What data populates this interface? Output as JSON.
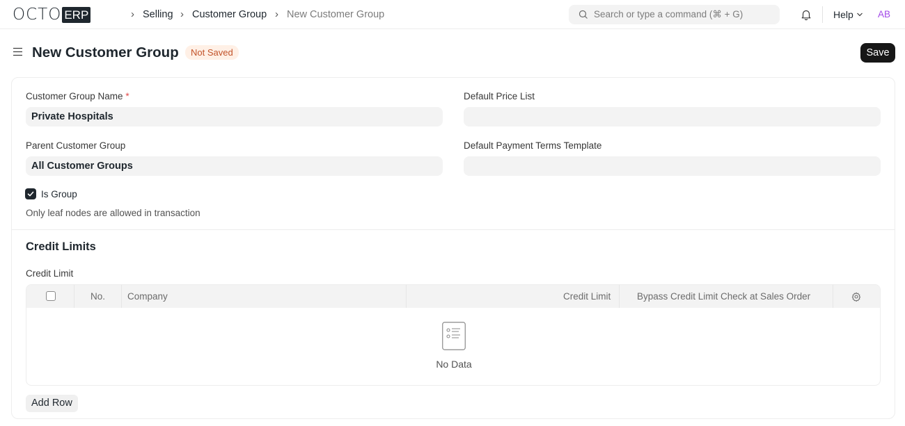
{
  "navbar": {
    "logo_text": "OCTO",
    "logo_badge": "ERP",
    "breadcrumbs": [
      "Selling",
      "Customer Group",
      "New Customer Group"
    ],
    "search_placeholder": "Search or type a command (⌘ + G)",
    "help_label": "Help",
    "avatar_initials": "AB"
  },
  "page": {
    "title": "New Customer Group",
    "status_badge": "Not Saved",
    "save_label": "Save"
  },
  "form": {
    "customer_group_name": {
      "label": "Customer Group Name",
      "required_mark": "*",
      "value": "Private Hospitals"
    },
    "default_price_list": {
      "label": "Default Price List",
      "value": ""
    },
    "parent_customer_group": {
      "label": "Parent Customer Group",
      "value": "All Customer Groups"
    },
    "default_payment_terms_template": {
      "label": "Default Payment Terms Template",
      "value": ""
    },
    "is_group": {
      "label": "Is Group",
      "checked": true,
      "description": "Only leaf nodes are allowed in transaction"
    }
  },
  "credit_section": {
    "title": "Credit Limits",
    "table_label": "Credit Limit",
    "columns": [
      "No.",
      "Company",
      "Credit Limit",
      "Bypass Credit Limit Check at Sales Order"
    ],
    "empty_text": "No Data",
    "add_row_label": "Add Row"
  },
  "colors": {
    "accent": "#171717",
    "badge_bg": "#fff0e6",
    "badge_text": "#c2532a",
    "avatar": "#a34ae8"
  }
}
